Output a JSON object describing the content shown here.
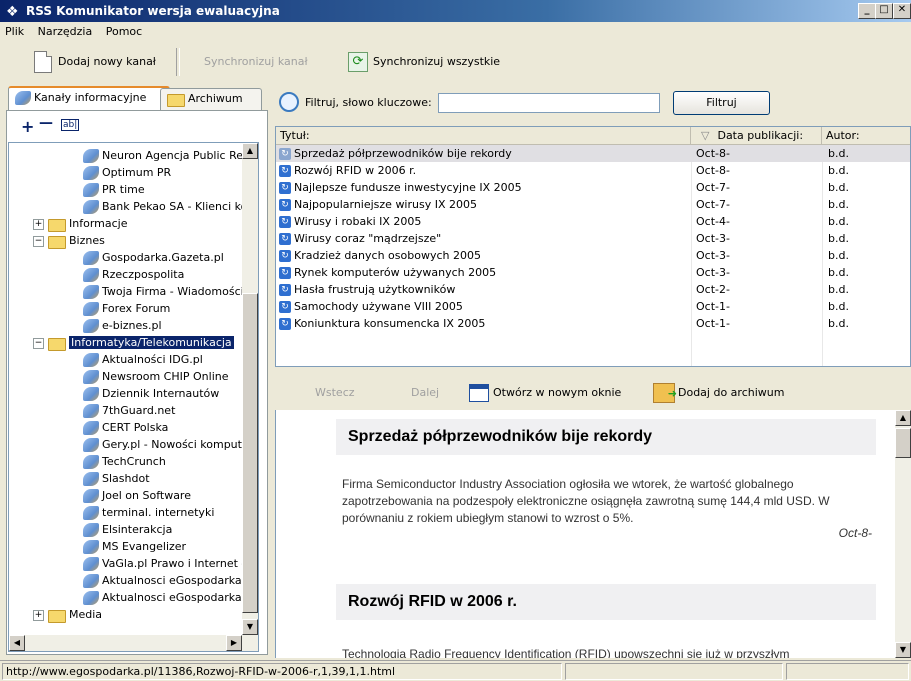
{
  "window": {
    "title": "RSS Komunikator wersja ewaluacyjna",
    "icon": "rss-feed-icon",
    "controls": [
      "_",
      "□",
      "✕"
    ]
  },
  "menu": [
    "Plik",
    "Narzędzia",
    "Pomoc"
  ],
  "toolbar": {
    "add_channel": "Dodaj nowy kanał",
    "sync_channel": "Synchronizuj kanał",
    "sync_all": "Synchronizuj wszystkie"
  },
  "left_tabs": {
    "channels": "Kanały informacyjne",
    "archive": "Archiwum"
  },
  "tree_tools": {
    "add": "+",
    "remove": "—",
    "rename": "ab|"
  },
  "tree": [
    {
      "label": "Neuron Agencja Public Rela",
      "type": "feed",
      "level": 2
    },
    {
      "label": "Optimum PR",
      "type": "feed",
      "level": 2
    },
    {
      "label": "PR time",
      "type": "feed",
      "level": 2
    },
    {
      "label": "Bank Pekao SA - Klienci korp",
      "type": "feed",
      "level": 2
    },
    {
      "label": "Informacje",
      "type": "folder",
      "level": 1,
      "expander": "+"
    },
    {
      "label": "Biznes",
      "type": "folder",
      "level": 1,
      "expander": "−"
    },
    {
      "label": "Gospodarka.Gazeta.pl",
      "type": "feed",
      "level": 2
    },
    {
      "label": "Rzeczpospolita",
      "type": "feed",
      "level": 2
    },
    {
      "label": "Twoja Firma - Wiadomości",
      "type": "feed",
      "level": 2
    },
    {
      "label": "Forex Forum",
      "type": "feed",
      "level": 2
    },
    {
      "label": "e-biznes.pl",
      "type": "feed",
      "level": 2
    },
    {
      "label": "Informatyka/Telekomunikacja",
      "type": "folder",
      "level": 1,
      "expander": "−",
      "selected": true
    },
    {
      "label": "Aktualności IDG.pl",
      "type": "feed",
      "level": 2
    },
    {
      "label": "Newsroom CHIP Online",
      "type": "feed",
      "level": 2
    },
    {
      "label": "Dziennik Internautów",
      "type": "feed",
      "level": 2
    },
    {
      "label": "7thGuard.net",
      "type": "feed",
      "level": 2
    },
    {
      "label": "CERT Polska",
      "type": "feed",
      "level": 2
    },
    {
      "label": "Gery.pl - Nowości komputer",
      "type": "feed",
      "level": 2
    },
    {
      "label": "TechCrunch",
      "type": "feed",
      "level": 2
    },
    {
      "label": "Slashdot",
      "type": "feed",
      "level": 2
    },
    {
      "label": "Joel on Software",
      "type": "feed",
      "level": 2
    },
    {
      "label": "terminal. internetyki",
      "type": "feed",
      "level": 2
    },
    {
      "label": "Elsinterakcja",
      "type": "feed",
      "level": 2
    },
    {
      "label": "MS Evangelizer",
      "type": "feed",
      "level": 2
    },
    {
      "label": "VaGla.pl Prawo i Internet -",
      "type": "feed",
      "level": 2
    },
    {
      "label": "Aktualnosci eGospodarka.p",
      "type": "feed",
      "level": 2
    },
    {
      "label": "Aktualnosci eGospodarka.p",
      "type": "feed",
      "level": 2
    },
    {
      "label": "Media",
      "type": "folder",
      "level": 1,
      "expander": "+"
    }
  ],
  "filter": {
    "label": "Filtruj, słowo kluczowe:",
    "value": "",
    "button": "Filtruj"
  },
  "table": {
    "headers": {
      "title": "Tytuł:",
      "date": "Data publikacji:",
      "author": "Autor:",
      "sort_icon": "▽"
    },
    "rows": [
      {
        "title": "Sprzedaż półprzewodników bije rekordy",
        "date": "Oct-8-",
        "author": "b.d.",
        "selected": true
      },
      {
        "title": "Rozwój RFID w 2006 r.",
        "date": "Oct-8-",
        "author": "b.d."
      },
      {
        "title": "Najlepsze fundusze inwestycyjne IX 2005",
        "date": "Oct-7-",
        "author": "b.d."
      },
      {
        "title": "Najpopularniejsze wirusy IX 2005",
        "date": "Oct-7-",
        "author": "b.d."
      },
      {
        "title": "Wirusy i robaki IX 2005",
        "date": "Oct-4-",
        "author": "b.d."
      },
      {
        "title": "Wirusy coraz \"mądrzejsze\"",
        "date": "Oct-3-",
        "author": "b.d."
      },
      {
        "title": "Kradzież danych osobowych 2005",
        "date": "Oct-3-",
        "author": "b.d."
      },
      {
        "title": "Rynek komputerów używanych 2005",
        "date": "Oct-3-",
        "author": "b.d."
      },
      {
        "title": "Hasła frustrują użytkowników",
        "date": "Oct-2-",
        "author": "b.d."
      },
      {
        "title": "Samochody używane VIII 2005",
        "date": "Oct-1-",
        "author": "b.d."
      },
      {
        "title": "Koniunktura konsumencka IX 2005",
        "date": "Oct-1-",
        "author": "b.d."
      }
    ]
  },
  "nav": {
    "back": "Wstecz",
    "forward": "Dalej",
    "open_new": "Otwórz w nowym oknie",
    "add_archive": "Dodaj do archiwum"
  },
  "articles": [
    {
      "title": "Sprzedaż półprzewodników bije rekordy",
      "body": "Firma Semiconductor Industry Association ogłosiła we wtorek, że wartość globalnego zapotrzebowania na podzespoły elektroniczne osiągnęła zawrotną sumę 144,4 mld USD. W porównaniu z rokiem ubiegłym stanowi to wzrost o 5%.",
      "date": "Oct-8-"
    },
    {
      "title": "Rozwój RFID w 2006 r.",
      "body": "Technologia Radio Frequency Identification (RFID) upowszechni się już w przyszłym"
    }
  ],
  "status": {
    "url": "http://www.egospodarka.pl/11386,Rozwoj-RFID-w-2006-r,1,39,1,1.html"
  }
}
